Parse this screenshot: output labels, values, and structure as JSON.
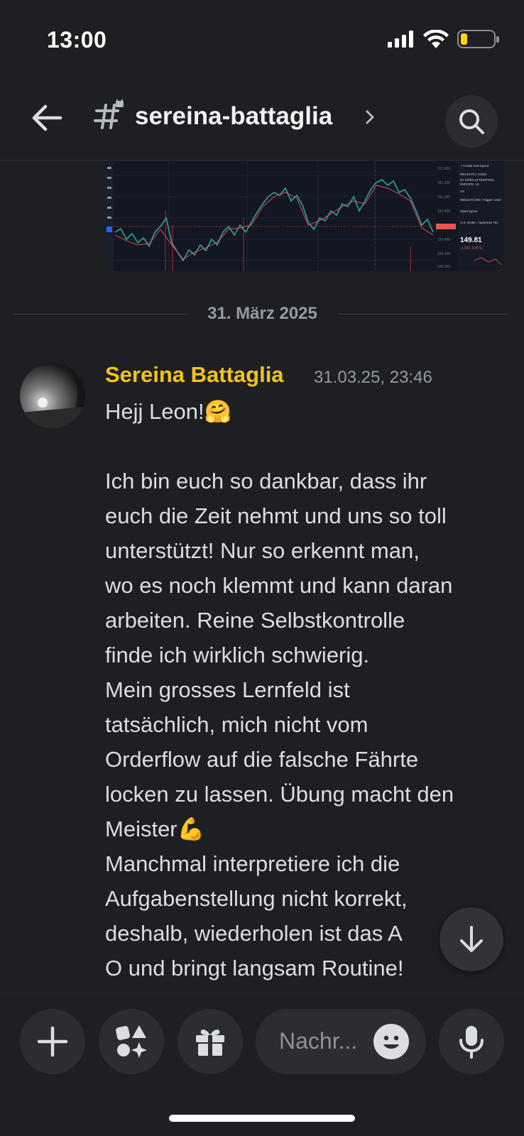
{
  "status_bar": {
    "time": "13:00"
  },
  "header": {
    "channel_name": "sereina-battaglia"
  },
  "divider": {
    "date": "31. März 2025"
  },
  "message": {
    "author": "Sereina Battaglia",
    "timestamp": "31.03.25, 23:46",
    "lines": [
      "Hejj Leon!🤗",
      "",
      "Ich bin euch so dankbar, dass ihr",
      "euch die Zeit nehmt und uns so toll",
      "unterstützt! Nur so erkennt man,",
      "wo es noch klemmt und kann daran",
      "arbeiten. Reine Selbstkontrolle",
      "finde ich wirklich schwierig.",
      "Mein grosses Lernfeld ist",
      "tatsächlich, mich nicht vom",
      "Orderflow auf die falsche Fährte",
      "locken zu lassen. Übung macht den",
      "Meister💪",
      "Manchmal interpretiere ich die",
      "Aufgabenstellung nicht korrekt,",
      "deshalb, wiederholen ist das A",
      "O und bringt langsam Routine!"
    ]
  },
  "attachment": {
    "price": "149.81",
    "change": "-1.320 -0.87%"
  },
  "composer": {
    "placeholder": "Nachr..."
  },
  "colors": {
    "background": "#1e1f23",
    "author": "#f0c419",
    "muted": "#949ba4",
    "button_bg": "#2b2d31"
  }
}
